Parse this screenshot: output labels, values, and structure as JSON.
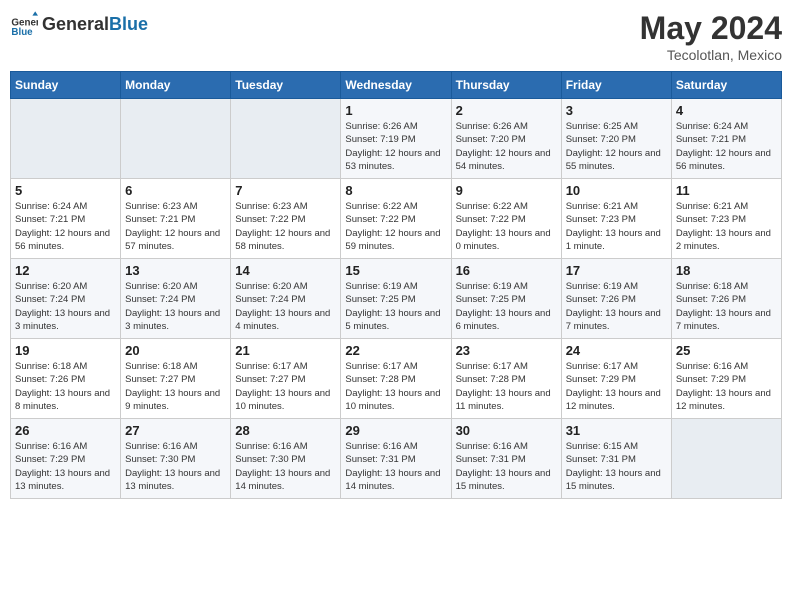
{
  "header": {
    "logo_general": "General",
    "logo_blue": "Blue",
    "month_year": "May 2024",
    "location": "Tecolotlan, Mexico"
  },
  "weekdays": [
    "Sunday",
    "Monday",
    "Tuesday",
    "Wednesday",
    "Thursday",
    "Friday",
    "Saturday"
  ],
  "weeks": [
    [
      {
        "day": "",
        "sunrise": "",
        "sunset": "",
        "daylight": "",
        "empty": true
      },
      {
        "day": "",
        "sunrise": "",
        "sunset": "",
        "daylight": "",
        "empty": true
      },
      {
        "day": "",
        "sunrise": "",
        "sunset": "",
        "daylight": "",
        "empty": true
      },
      {
        "day": "1",
        "sunrise": "Sunrise: 6:26 AM",
        "sunset": "Sunset: 7:19 PM",
        "daylight": "Daylight: 12 hours and 53 minutes.",
        "empty": false
      },
      {
        "day": "2",
        "sunrise": "Sunrise: 6:26 AM",
        "sunset": "Sunset: 7:20 PM",
        "daylight": "Daylight: 12 hours and 54 minutes.",
        "empty": false
      },
      {
        "day": "3",
        "sunrise": "Sunrise: 6:25 AM",
        "sunset": "Sunset: 7:20 PM",
        "daylight": "Daylight: 12 hours and 55 minutes.",
        "empty": false
      },
      {
        "day": "4",
        "sunrise": "Sunrise: 6:24 AM",
        "sunset": "Sunset: 7:21 PM",
        "daylight": "Daylight: 12 hours and 56 minutes.",
        "empty": false
      }
    ],
    [
      {
        "day": "5",
        "sunrise": "Sunrise: 6:24 AM",
        "sunset": "Sunset: 7:21 PM",
        "daylight": "Daylight: 12 hours and 56 minutes.",
        "empty": false
      },
      {
        "day": "6",
        "sunrise": "Sunrise: 6:23 AM",
        "sunset": "Sunset: 7:21 PM",
        "daylight": "Daylight: 12 hours and 57 minutes.",
        "empty": false
      },
      {
        "day": "7",
        "sunrise": "Sunrise: 6:23 AM",
        "sunset": "Sunset: 7:22 PM",
        "daylight": "Daylight: 12 hours and 58 minutes.",
        "empty": false
      },
      {
        "day": "8",
        "sunrise": "Sunrise: 6:22 AM",
        "sunset": "Sunset: 7:22 PM",
        "daylight": "Daylight: 12 hours and 59 minutes.",
        "empty": false
      },
      {
        "day": "9",
        "sunrise": "Sunrise: 6:22 AM",
        "sunset": "Sunset: 7:22 PM",
        "daylight": "Daylight: 13 hours and 0 minutes.",
        "empty": false
      },
      {
        "day": "10",
        "sunrise": "Sunrise: 6:21 AM",
        "sunset": "Sunset: 7:23 PM",
        "daylight": "Daylight: 13 hours and 1 minute.",
        "empty": false
      },
      {
        "day": "11",
        "sunrise": "Sunrise: 6:21 AM",
        "sunset": "Sunset: 7:23 PM",
        "daylight": "Daylight: 13 hours and 2 minutes.",
        "empty": false
      }
    ],
    [
      {
        "day": "12",
        "sunrise": "Sunrise: 6:20 AM",
        "sunset": "Sunset: 7:24 PM",
        "daylight": "Daylight: 13 hours and 3 minutes.",
        "empty": false
      },
      {
        "day": "13",
        "sunrise": "Sunrise: 6:20 AM",
        "sunset": "Sunset: 7:24 PM",
        "daylight": "Daylight: 13 hours and 3 minutes.",
        "empty": false
      },
      {
        "day": "14",
        "sunrise": "Sunrise: 6:20 AM",
        "sunset": "Sunset: 7:24 PM",
        "daylight": "Daylight: 13 hours and 4 minutes.",
        "empty": false
      },
      {
        "day": "15",
        "sunrise": "Sunrise: 6:19 AM",
        "sunset": "Sunset: 7:25 PM",
        "daylight": "Daylight: 13 hours and 5 minutes.",
        "empty": false
      },
      {
        "day": "16",
        "sunrise": "Sunrise: 6:19 AM",
        "sunset": "Sunset: 7:25 PM",
        "daylight": "Daylight: 13 hours and 6 minutes.",
        "empty": false
      },
      {
        "day": "17",
        "sunrise": "Sunrise: 6:19 AM",
        "sunset": "Sunset: 7:26 PM",
        "daylight": "Daylight: 13 hours and 7 minutes.",
        "empty": false
      },
      {
        "day": "18",
        "sunrise": "Sunrise: 6:18 AM",
        "sunset": "Sunset: 7:26 PM",
        "daylight": "Daylight: 13 hours and 7 minutes.",
        "empty": false
      }
    ],
    [
      {
        "day": "19",
        "sunrise": "Sunrise: 6:18 AM",
        "sunset": "Sunset: 7:26 PM",
        "daylight": "Daylight: 13 hours and 8 minutes.",
        "empty": false
      },
      {
        "day": "20",
        "sunrise": "Sunrise: 6:18 AM",
        "sunset": "Sunset: 7:27 PM",
        "daylight": "Daylight: 13 hours and 9 minutes.",
        "empty": false
      },
      {
        "day": "21",
        "sunrise": "Sunrise: 6:17 AM",
        "sunset": "Sunset: 7:27 PM",
        "daylight": "Daylight: 13 hours and 10 minutes.",
        "empty": false
      },
      {
        "day": "22",
        "sunrise": "Sunrise: 6:17 AM",
        "sunset": "Sunset: 7:28 PM",
        "daylight": "Daylight: 13 hours and 10 minutes.",
        "empty": false
      },
      {
        "day": "23",
        "sunrise": "Sunrise: 6:17 AM",
        "sunset": "Sunset: 7:28 PM",
        "daylight": "Daylight: 13 hours and 11 minutes.",
        "empty": false
      },
      {
        "day": "24",
        "sunrise": "Sunrise: 6:17 AM",
        "sunset": "Sunset: 7:29 PM",
        "daylight": "Daylight: 13 hours and 12 minutes.",
        "empty": false
      },
      {
        "day": "25",
        "sunrise": "Sunrise: 6:16 AM",
        "sunset": "Sunset: 7:29 PM",
        "daylight": "Daylight: 13 hours and 12 minutes.",
        "empty": false
      }
    ],
    [
      {
        "day": "26",
        "sunrise": "Sunrise: 6:16 AM",
        "sunset": "Sunset: 7:29 PM",
        "daylight": "Daylight: 13 hours and 13 minutes.",
        "empty": false
      },
      {
        "day": "27",
        "sunrise": "Sunrise: 6:16 AM",
        "sunset": "Sunset: 7:30 PM",
        "daylight": "Daylight: 13 hours and 13 minutes.",
        "empty": false
      },
      {
        "day": "28",
        "sunrise": "Sunrise: 6:16 AM",
        "sunset": "Sunset: 7:30 PM",
        "daylight": "Daylight: 13 hours and 14 minutes.",
        "empty": false
      },
      {
        "day": "29",
        "sunrise": "Sunrise: 6:16 AM",
        "sunset": "Sunset: 7:31 PM",
        "daylight": "Daylight: 13 hours and 14 minutes.",
        "empty": false
      },
      {
        "day": "30",
        "sunrise": "Sunrise: 6:16 AM",
        "sunset": "Sunset: 7:31 PM",
        "daylight": "Daylight: 13 hours and 15 minutes.",
        "empty": false
      },
      {
        "day": "31",
        "sunrise": "Sunrise: 6:15 AM",
        "sunset": "Sunset: 7:31 PM",
        "daylight": "Daylight: 13 hours and 15 minutes.",
        "empty": false
      },
      {
        "day": "",
        "sunrise": "",
        "sunset": "",
        "daylight": "",
        "empty": true
      }
    ]
  ]
}
